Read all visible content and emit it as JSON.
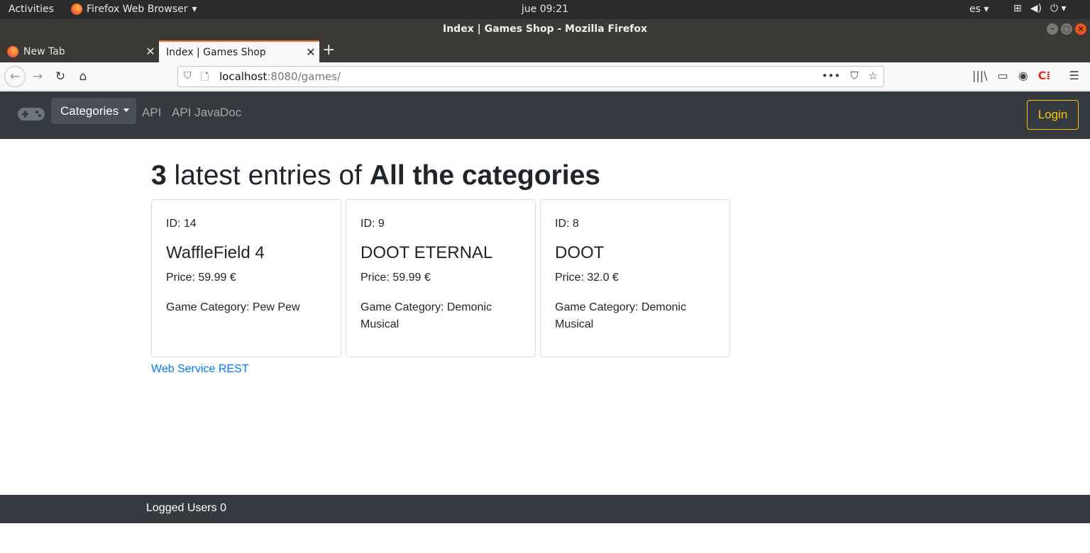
{
  "system": {
    "activities": "Activities",
    "app_menu": "Firefox Web Browser",
    "clock": "jue 09:21",
    "language": "es"
  },
  "window": {
    "title": "Index | Games Shop - Mozilla Firefox"
  },
  "tabs": [
    {
      "label": "New Tab",
      "active": false
    },
    {
      "label": "Index | Games Shop",
      "active": true
    }
  ],
  "address": {
    "host": "localhost",
    "rest": ":8080/games/"
  },
  "site_nav": {
    "categories_label": "Categories",
    "links": [
      "API",
      "API JavaDoc"
    ],
    "login_label": "Login"
  },
  "main": {
    "count": "3",
    "heading_mid": " latest entries of ",
    "scope": "All the categories",
    "games": [
      {
        "id_text": "ID: 14",
        "name": "WaffleField 4",
        "price_text": "Price: 59.99 €",
        "category_text": "Game Category: Pew Pew"
      },
      {
        "id_text": "ID: 9",
        "name": "DOOT ETERNAL",
        "price_text": "Price: 59.99 €",
        "category_text": "Game Category: Demonic Musical"
      },
      {
        "id_text": "ID: 8",
        "name": "DOOT",
        "price_text": "Price: 32.0 €",
        "category_text": "Game Category: Demonic Musical"
      }
    ],
    "rest_link": "Web Service REST"
  },
  "footer": {
    "text": "Logged Users 0"
  },
  "colors": {
    "navbar_bg": "#343a40",
    "login_accent": "#ffc107",
    "link": "#007bff"
  }
}
